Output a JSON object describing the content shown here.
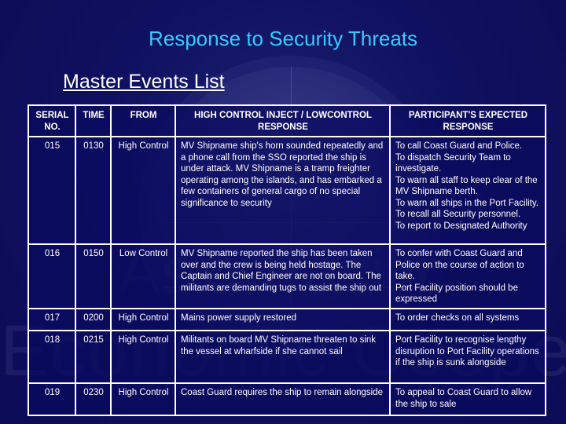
{
  "title": "Response to Security Threats",
  "subtitle": "Master Events List",
  "watermark": {
    "line1": "Asia-Pacific",
    "line2": "Economic Cooperation"
  },
  "colors": {
    "background": "#0b0b55",
    "title": "#33ccff",
    "text": "#ffffff",
    "border": "#ffffff"
  },
  "table": {
    "headers": {
      "serial": "SERIAL NO.",
      "time": "TIME",
      "from": "FROM",
      "inject": "HIGH CONTROL INJECT / LOWCONTROL RESPONSE",
      "expected": "PARTICIPANT'S EXPECTED RESPONSE"
    },
    "rows": [
      {
        "serial": "015",
        "time": "0130",
        "from": "High Control",
        "inject": "MV Shipname ship's horn sounded repeatedly and a phone call from the SSO reported the ship is under attack. MV Shipname is a tramp freighter operating among the islands, and has embarked a few containers of general cargo of no special significance to security",
        "expected": [
          "To call Coast Guard and Police.",
          "To dispatch Security Team to investigate.",
          "To warn all staff to keep clear of the MV Shipname berth.",
          "To warn all ships in the Port Facility.",
          "To recall all Security personnel.",
          "To report to Designated Authority"
        ]
      },
      {
        "serial": "016",
        "time": "0150",
        "from": "Low Control",
        "inject": "MV Shipname reported the ship has been taken over and the crew is being held hostage. The Captain and Chief Engineer are not on board. The militants are demanding tugs to assist the ship out",
        "expected": [
          "To confer with Coast Guard and Police on the course of action to take.",
          "Port Facility position should be expressed"
        ]
      },
      {
        "serial": "017",
        "time": "0200",
        "from": "High Control",
        "inject": "Mains power supply restored",
        "expected": [
          "To order checks on all systems"
        ]
      },
      {
        "serial": "018",
        "time": "0215",
        "from": "High Control",
        "inject": "Militants on board MV Shipname threaten to sink the vessel at wharfside if she cannot sail",
        "expected": [
          "Port Facility to recognise lengthy disruption to Port Facility operations if the ship is sunk alongside"
        ]
      },
      {
        "serial": "019",
        "time": "0230",
        "from": "High Control",
        "inject": "Coast Guard requires the ship to remain alongside",
        "expected": [
          "To appeal to Coast Guard to allow the ship to sale"
        ]
      }
    ]
  }
}
